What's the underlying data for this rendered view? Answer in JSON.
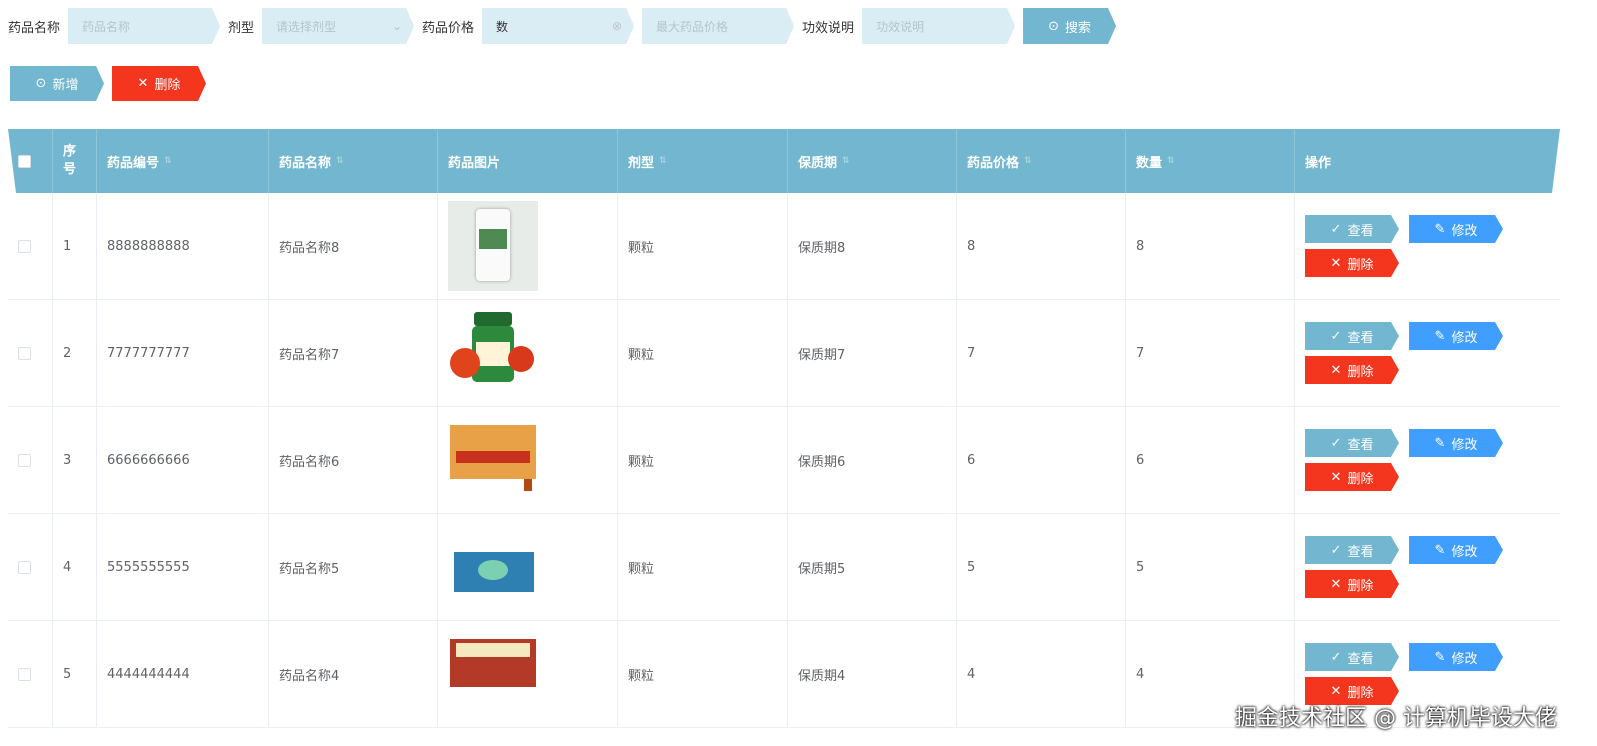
{
  "search": {
    "name_label": "药品名称",
    "name_placeholder": "药品名称",
    "type_label": "剂型",
    "type_placeholder": "请选择剂型",
    "price_label": "药品价格",
    "price_min_value": "数",
    "price_max_placeholder": "最大药品价格",
    "effect_label": "功效说明",
    "effect_placeholder": "功效说明",
    "search_button": "搜索"
  },
  "toolbar": {
    "add_button": "新增",
    "delete_button": "删除"
  },
  "table": {
    "headers": [
      "序号",
      "药品编号",
      "药品名称",
      "药品图片",
      "剂型",
      "保质期",
      "药品价格",
      "数量",
      "操作"
    ],
    "actions": {
      "view": "查看",
      "edit": "修改",
      "delete": "删除"
    },
    "rows": [
      {
        "index": "1",
        "code": "8888888888",
        "name": "药品名称8",
        "form": "颗粒",
        "shelf": "保质期8",
        "price": "8",
        "qty": "8",
        "image": "white-bottle"
      },
      {
        "index": "2",
        "code": "7777777777",
        "name": "药品名称7",
        "form": "颗粒",
        "shelf": "保质期7",
        "price": "7",
        "qty": "7",
        "image": "green-bottle"
      },
      {
        "index": "3",
        "code": "6666666666",
        "name": "药品名称6",
        "form": "颗粒",
        "shelf": "保质期6",
        "price": "6",
        "qty": "6",
        "image": "orange-box"
      },
      {
        "index": "4",
        "code": "5555555555",
        "name": "药品名称5",
        "form": "颗粒",
        "shelf": "保质期5",
        "price": "5",
        "qty": "5",
        "image": "blue-box"
      },
      {
        "index": "5",
        "code": "4444444444",
        "name": "药品名称4",
        "form": "颗粒",
        "shelf": "保质期4",
        "price": "4",
        "qty": "4",
        "image": "red-box"
      }
    ]
  },
  "colors": {
    "primary": "#73b6cf",
    "danger": "#f5361e",
    "edit": "#409eff"
  },
  "watermark": "掘金技术社区 @ 计算机毕设大佬"
}
